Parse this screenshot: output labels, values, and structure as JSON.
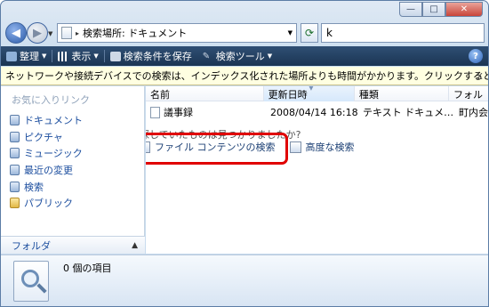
{
  "window": {
    "minimize": "—",
    "maximize": "□",
    "close": "✕"
  },
  "address": {
    "path": "検索場所: ドキュメント",
    "search_value": "k",
    "refresh_icon": "refresh-icon"
  },
  "toolbar": {
    "organize": "整理",
    "views": "表示",
    "save_search": "検索条件を保存",
    "search_tools": "検索ツール",
    "help": "?"
  },
  "infobar": {
    "text": "ネットワークや接続デバイスでの検索は、インデックス化された場所よりも時間がかかります。クリックするとヘルプ…",
    "close": "x"
  },
  "navigation": {
    "header": "お気に入りリンク",
    "items": [
      {
        "label": "ドキュメント",
        "icon": "documents-icon"
      },
      {
        "label": "ピクチャ",
        "icon": "pictures-icon"
      },
      {
        "label": "ミュージック",
        "icon": "music-icon"
      },
      {
        "label": "最近の変更",
        "icon": "recent-icon"
      },
      {
        "label": "検索",
        "icon": "search-icon"
      },
      {
        "label": "パブリック",
        "icon": "folder-icon"
      }
    ],
    "folders_label": "フォルダ"
  },
  "columns": [
    "名前",
    "更新日時",
    "種類",
    "フォル"
  ],
  "files": [
    {
      "name": "議事録",
      "modified": "2008/04/14 16:18",
      "type": "テキスト ドキュメ…",
      "folder": "町内会"
    }
  ],
  "search_hint": "探していたものは見つかりましたか?",
  "search_options": {
    "file_contents": "ファイル コンテンツの検索",
    "advanced": "高度な検索"
  },
  "details": {
    "count": "0 個の項目"
  },
  "colors": {
    "toolbar": "#1b3553",
    "highlight": "#e00000",
    "link": "#1b4d9e",
    "infobar": "#ffffe1"
  }
}
